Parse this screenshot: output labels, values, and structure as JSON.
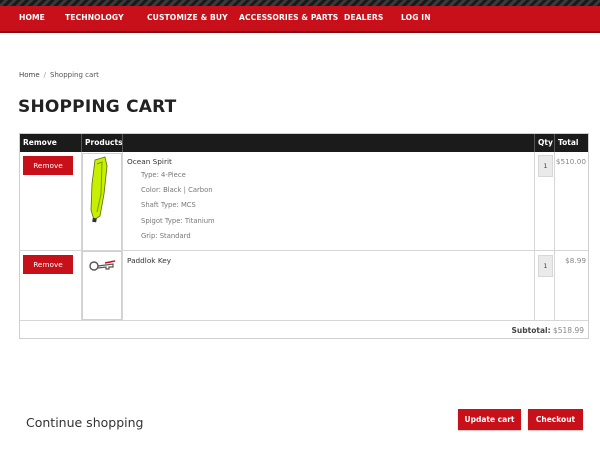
{
  "nav": {
    "items": [
      "HOME",
      "TECHNOLOGY",
      "CUSTOMIZE & BUY",
      "ACCESSORIES & PARTS",
      "DEALERS",
      "LOG IN"
    ]
  },
  "breadcrumb": {
    "home": "Home",
    "separator": "/",
    "current": "Shopping cart"
  },
  "page": {
    "title": "SHOPPING CART"
  },
  "table": {
    "headers": {
      "remove": "Remove",
      "products": "Products",
      "qty": "Qty",
      "total": "Total"
    },
    "rows": [
      {
        "remove_label": "Remove",
        "product": "Ocean Spirit",
        "attributes": [
          "Type: 4-Piece",
          "Color: Black | Carbon",
          "Shaft Type: MCS",
          "Spigot Type: Titanium",
          "Grip: Standard"
        ],
        "qty": "1",
        "total": "$510.00",
        "thumb_icon": "paddle-blade-icon"
      },
      {
        "remove_label": "Remove",
        "product": "Paddlok Key",
        "attributes": [],
        "qty": "1",
        "total": "$8.99",
        "thumb_icon": "key-icon"
      }
    ],
    "subtotal_label": "Subtotal:",
    "subtotal_value": "$518.99"
  },
  "footer": {
    "continue_label": "Continue shopping",
    "update_label": "Update cart",
    "checkout_label": "Checkout"
  },
  "colors": {
    "brand_red": "#c8101a",
    "header_black": "#1b1b1b",
    "paddle_yellow": "#c6f000"
  }
}
